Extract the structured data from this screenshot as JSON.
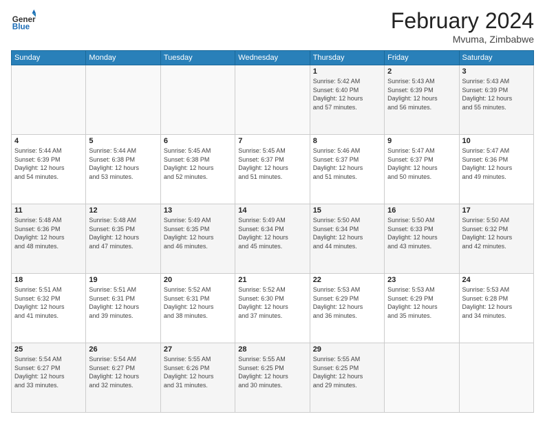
{
  "logo": {
    "general": "General",
    "blue": "Blue"
  },
  "title": {
    "month": "February 2024",
    "location": "Mvuma, Zimbabwe"
  },
  "days_header": [
    "Sunday",
    "Monday",
    "Tuesday",
    "Wednesday",
    "Thursday",
    "Friday",
    "Saturday"
  ],
  "weeks": [
    [
      {
        "day": "",
        "info": ""
      },
      {
        "day": "",
        "info": ""
      },
      {
        "day": "",
        "info": ""
      },
      {
        "day": "",
        "info": ""
      },
      {
        "day": "1",
        "info": "Sunrise: 5:42 AM\nSunset: 6:40 PM\nDaylight: 12 hours\nand 57 minutes."
      },
      {
        "day": "2",
        "info": "Sunrise: 5:43 AM\nSunset: 6:39 PM\nDaylight: 12 hours\nand 56 minutes."
      },
      {
        "day": "3",
        "info": "Sunrise: 5:43 AM\nSunset: 6:39 PM\nDaylight: 12 hours\nand 55 minutes."
      }
    ],
    [
      {
        "day": "4",
        "info": "Sunrise: 5:44 AM\nSunset: 6:39 PM\nDaylight: 12 hours\nand 54 minutes."
      },
      {
        "day": "5",
        "info": "Sunrise: 5:44 AM\nSunset: 6:38 PM\nDaylight: 12 hours\nand 53 minutes."
      },
      {
        "day": "6",
        "info": "Sunrise: 5:45 AM\nSunset: 6:38 PM\nDaylight: 12 hours\nand 52 minutes."
      },
      {
        "day": "7",
        "info": "Sunrise: 5:45 AM\nSunset: 6:37 PM\nDaylight: 12 hours\nand 51 minutes."
      },
      {
        "day": "8",
        "info": "Sunrise: 5:46 AM\nSunset: 6:37 PM\nDaylight: 12 hours\nand 51 minutes."
      },
      {
        "day": "9",
        "info": "Sunrise: 5:47 AM\nSunset: 6:37 PM\nDaylight: 12 hours\nand 50 minutes."
      },
      {
        "day": "10",
        "info": "Sunrise: 5:47 AM\nSunset: 6:36 PM\nDaylight: 12 hours\nand 49 minutes."
      }
    ],
    [
      {
        "day": "11",
        "info": "Sunrise: 5:48 AM\nSunset: 6:36 PM\nDaylight: 12 hours\nand 48 minutes."
      },
      {
        "day": "12",
        "info": "Sunrise: 5:48 AM\nSunset: 6:35 PM\nDaylight: 12 hours\nand 47 minutes."
      },
      {
        "day": "13",
        "info": "Sunrise: 5:49 AM\nSunset: 6:35 PM\nDaylight: 12 hours\nand 46 minutes."
      },
      {
        "day": "14",
        "info": "Sunrise: 5:49 AM\nSunset: 6:34 PM\nDaylight: 12 hours\nand 45 minutes."
      },
      {
        "day": "15",
        "info": "Sunrise: 5:50 AM\nSunset: 6:34 PM\nDaylight: 12 hours\nand 44 minutes."
      },
      {
        "day": "16",
        "info": "Sunrise: 5:50 AM\nSunset: 6:33 PM\nDaylight: 12 hours\nand 43 minutes."
      },
      {
        "day": "17",
        "info": "Sunrise: 5:50 AM\nSunset: 6:32 PM\nDaylight: 12 hours\nand 42 minutes."
      }
    ],
    [
      {
        "day": "18",
        "info": "Sunrise: 5:51 AM\nSunset: 6:32 PM\nDaylight: 12 hours\nand 41 minutes."
      },
      {
        "day": "19",
        "info": "Sunrise: 5:51 AM\nSunset: 6:31 PM\nDaylight: 12 hours\nand 39 minutes."
      },
      {
        "day": "20",
        "info": "Sunrise: 5:52 AM\nSunset: 6:31 PM\nDaylight: 12 hours\nand 38 minutes."
      },
      {
        "day": "21",
        "info": "Sunrise: 5:52 AM\nSunset: 6:30 PM\nDaylight: 12 hours\nand 37 minutes."
      },
      {
        "day": "22",
        "info": "Sunrise: 5:53 AM\nSunset: 6:29 PM\nDaylight: 12 hours\nand 36 minutes."
      },
      {
        "day": "23",
        "info": "Sunrise: 5:53 AM\nSunset: 6:29 PM\nDaylight: 12 hours\nand 35 minutes."
      },
      {
        "day": "24",
        "info": "Sunrise: 5:53 AM\nSunset: 6:28 PM\nDaylight: 12 hours\nand 34 minutes."
      }
    ],
    [
      {
        "day": "25",
        "info": "Sunrise: 5:54 AM\nSunset: 6:27 PM\nDaylight: 12 hours\nand 33 minutes."
      },
      {
        "day": "26",
        "info": "Sunrise: 5:54 AM\nSunset: 6:27 PM\nDaylight: 12 hours\nand 32 minutes."
      },
      {
        "day": "27",
        "info": "Sunrise: 5:55 AM\nSunset: 6:26 PM\nDaylight: 12 hours\nand 31 minutes."
      },
      {
        "day": "28",
        "info": "Sunrise: 5:55 AM\nSunset: 6:25 PM\nDaylight: 12 hours\nand 30 minutes."
      },
      {
        "day": "29",
        "info": "Sunrise: 5:55 AM\nSunset: 6:25 PM\nDaylight: 12 hours\nand 29 minutes."
      },
      {
        "day": "",
        "info": ""
      },
      {
        "day": "",
        "info": ""
      }
    ]
  ]
}
